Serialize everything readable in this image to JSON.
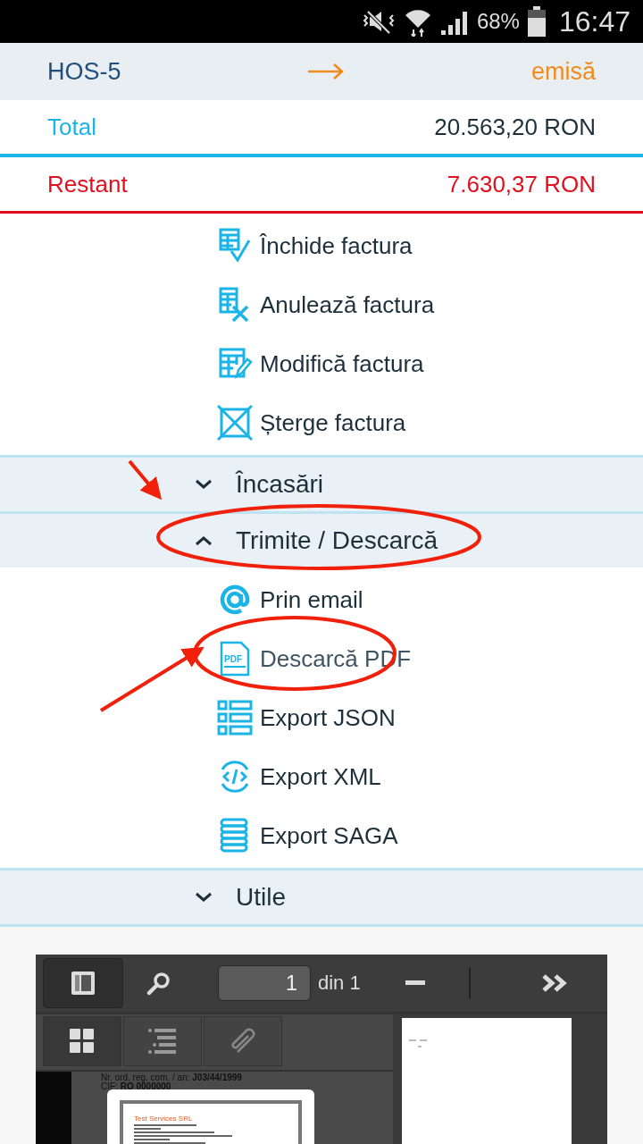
{
  "status_bar": {
    "battery": "68%",
    "time": "16:47"
  },
  "invoice": {
    "number": "HOS-5",
    "status": "emisă"
  },
  "totals": [
    {
      "kind": "total",
      "label": "Total",
      "value": "20.563,20 RON"
    },
    {
      "kind": "due",
      "label": "Restant",
      "value": "7.630,37 RON"
    }
  ],
  "actions": [
    {
      "kind": "close",
      "label": "Închide factura"
    },
    {
      "kind": "cancel",
      "label": "Anulează factura"
    },
    {
      "kind": "edit",
      "label": "Modifică factura"
    },
    {
      "kind": "delete",
      "label": "Șterge factura"
    }
  ],
  "sections": [
    {
      "title": "Încasări",
      "expanded": false
    },
    {
      "title": "Trimite / Descarcă",
      "expanded": true,
      "items": [
        {
          "kind": "email",
          "label": "Prin email"
        },
        {
          "kind": "pdf",
          "label": "Descarcă PDF",
          "icon_text": "PDF"
        },
        {
          "kind": "json",
          "label": "Export JSON"
        },
        {
          "kind": "xml",
          "label": "Export XML"
        },
        {
          "kind": "saga",
          "label": "Export SAGA"
        }
      ]
    },
    {
      "title": "Utile",
      "expanded": false
    }
  ],
  "pdf_viewer": {
    "page": "1",
    "page_count": "din 1",
    "doc_lines": [
      "Nr. ord. reg. com. / an: **J03/44/1999**",
      "CIF: **RO 0000000**"
    ],
    "thumbnail_title": "Test Services SRL"
  }
}
